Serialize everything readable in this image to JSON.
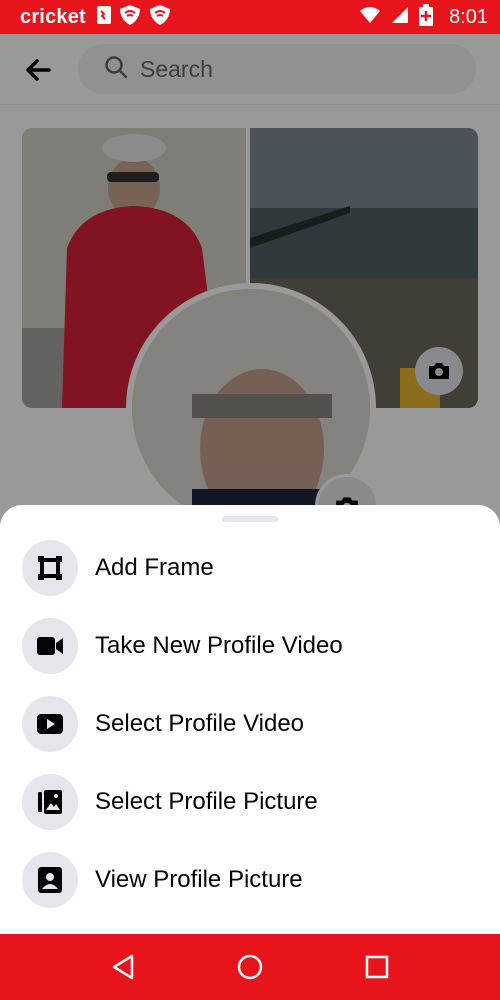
{
  "status_bar": {
    "carrier": "cricket",
    "time": "8:01",
    "bg_color": "#e8141c"
  },
  "search": {
    "placeholder": "Search"
  },
  "menu": {
    "items": [
      {
        "label": "Add Frame",
        "icon": "frame-icon"
      },
      {
        "label": "Take New Profile Video",
        "icon": "video-camera-icon"
      },
      {
        "label": "Select Profile Video",
        "icon": "play-icon"
      },
      {
        "label": "Select Profile Picture",
        "icon": "photo-album-icon"
      },
      {
        "label": "View Profile Picture",
        "icon": "person-portrait-icon"
      }
    ]
  },
  "nav_bar": {
    "buttons": [
      "back-triangle-icon",
      "home-circle-icon",
      "recents-square-icon"
    ],
    "bg_color": "#e8141c"
  }
}
